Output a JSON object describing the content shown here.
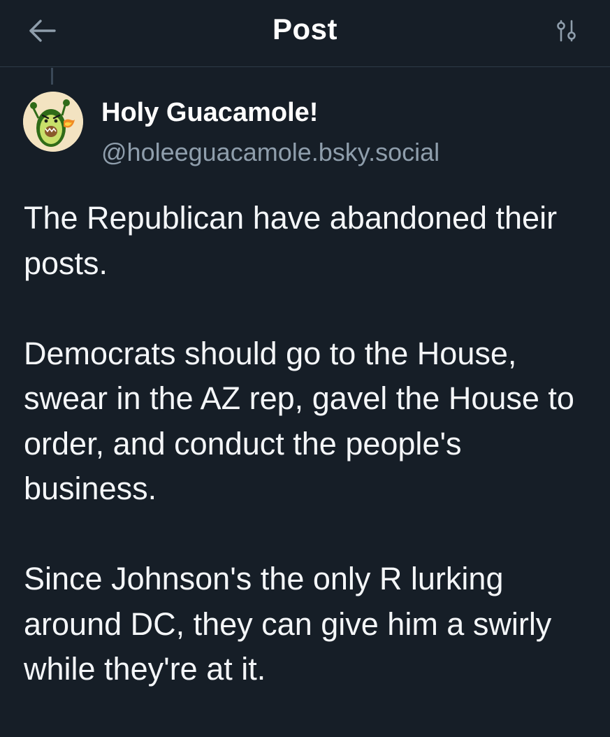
{
  "header": {
    "title": "Post",
    "back_icon": "arrow-left-icon",
    "filter_icon": "sliders-icon"
  },
  "post": {
    "author": {
      "display_name": "Holy Guacamole!",
      "handle": "@holeeguacamole.bsky.social",
      "avatar_icon": "angry-avocado-avatar"
    },
    "paragraphs": [
      "The Republican have abandoned their posts.",
      "Democrats should go to the House, swear in the AZ rep, gavel the House to order, and conduct the people's business.",
      "Since Johnson's the only R lurking around DC, they can give him a swirly while they're at it."
    ]
  },
  "colors": {
    "background": "#161e27",
    "divider": "#2e3b48",
    "text_primary": "#f4f6f8",
    "text_secondary": "#8f9eac",
    "avatar_bg": "#f3e3c1",
    "avocado_skin": "#3a7a1f",
    "avocado_flesh": "#c8e06a",
    "avocado_pit": "#8a5a2b"
  }
}
